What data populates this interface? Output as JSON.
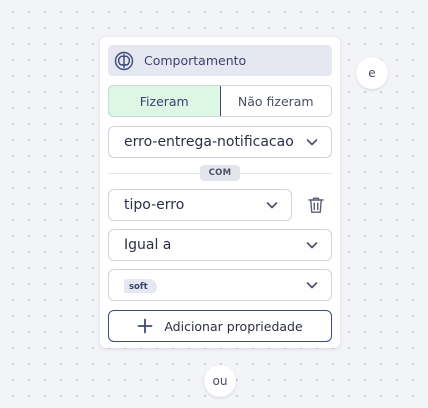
{
  "card": {
    "header": {
      "title": "Comportamento",
      "icon": "brain-icon"
    },
    "toggle": {
      "active_label": "Fizeram",
      "inactive_label": "Não fizeram",
      "active_color": "#dcf7e4"
    },
    "event_select": {
      "value": "erro-entrega-notificacao"
    },
    "separator_label": "COM",
    "property_select": {
      "value": "tipo-erro"
    },
    "operator_select": {
      "value": "Igual a"
    },
    "values_select": {
      "chips": [
        "soft"
      ]
    },
    "add_property_button": {
      "label": "Adicionar propriedade"
    }
  },
  "connectors": {
    "and_label": "e",
    "or_label": "ou"
  },
  "colors": {
    "accent": "#3c4a7a",
    "header_bg": "#e6e8f1",
    "border": "#cfd3dc"
  }
}
